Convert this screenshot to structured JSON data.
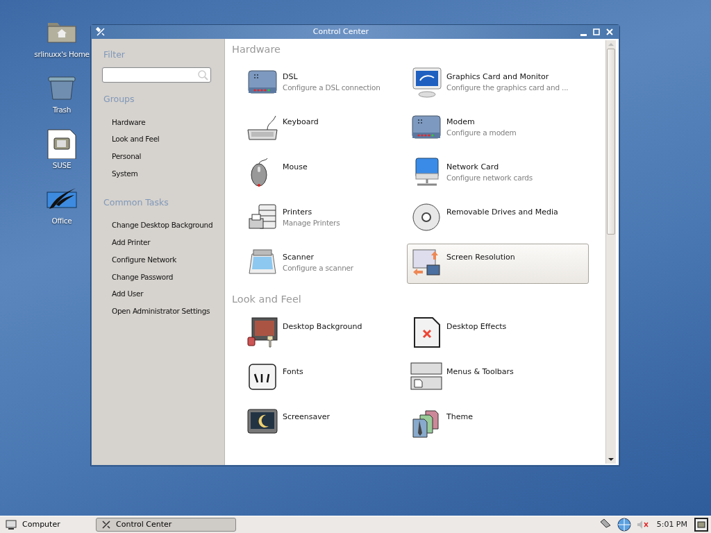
{
  "desktop_icons": [
    {
      "label": "srlinuxx's Home"
    },
    {
      "label": "Trash"
    },
    {
      "label": "SUSE"
    },
    {
      "label": "Office"
    }
  ],
  "window": {
    "title": "Control Center",
    "sidebar": {
      "filter_heading": "Filter",
      "groups_heading": "Groups",
      "groups": [
        "Hardware",
        "Look and Feel",
        "Personal",
        "System"
      ],
      "tasks_heading": "Common Tasks",
      "tasks": [
        "Change Desktop Background",
        "Add Printer",
        "Configure Network",
        "Change Password",
        "Add User",
        "Open Administrator Settings"
      ]
    },
    "sections": [
      {
        "heading": "Hardware",
        "items": [
          {
            "name": "DSL",
            "description": "Configure a DSL connection",
            "selected": false
          },
          {
            "name": "Graphics Card and Monitor",
            "description": "Configure the graphics card and ...",
            "selected": false
          },
          {
            "name": "Keyboard",
            "selected": false
          },
          {
            "name": "Modem",
            "description": "Configure a modem",
            "selected": false
          },
          {
            "name": "Mouse",
            "selected": false
          },
          {
            "name": "Network Card",
            "description": "Configure network cards",
            "selected": false
          },
          {
            "name": "Printers",
            "description": "Manage Printers",
            "selected": false
          },
          {
            "name": "Removable Drives and Media",
            "selected": false
          },
          {
            "name": "Scanner",
            "description": "Configure a scanner",
            "selected": false
          },
          {
            "name": "Screen Resolution",
            "selected": true
          }
        ]
      },
      {
        "heading": "Look and Feel",
        "items": [
          {
            "name": "Desktop Background",
            "selected": false
          },
          {
            "name": "Desktop Effects",
            "selected": false
          },
          {
            "name": "Fonts",
            "selected": false
          },
          {
            "name": "Menus & Toolbars",
            "selected": false
          },
          {
            "name": "Screensaver",
            "selected": false
          },
          {
            "name": "Theme",
            "selected": false
          }
        ]
      }
    ]
  },
  "taskbar": {
    "start_label": "Computer",
    "tasks": [
      {
        "label": "Control Center",
        "selected": true
      }
    ],
    "clock": "5:01 PM"
  }
}
